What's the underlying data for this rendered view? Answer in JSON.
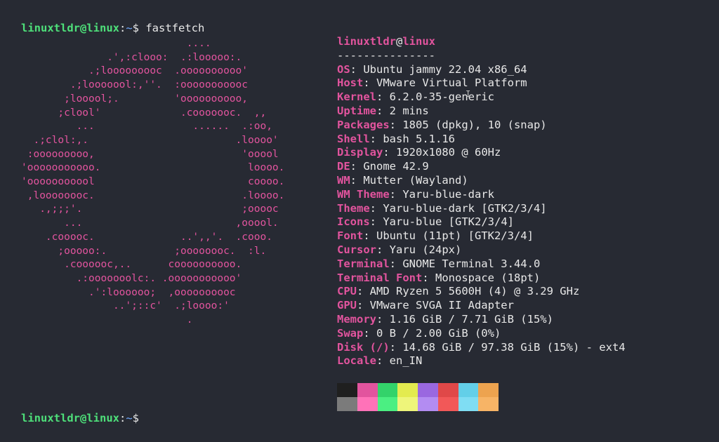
{
  "prompt": {
    "user_host": "linuxtldr@linux",
    "separator": ":",
    "path": "~",
    "dollar": "$ ",
    "command": "fastfetch"
  },
  "ascii_logo": [
    "                           ....",
    "              .',:clooo:  .:looooo:.",
    "           .;looooooooc  .oooooooooo'",
    "        .;looooool:,''.  :ooooooooooc",
    "       ;looool;.         'oooooooooo,",
    "      ;clool'             .cooooooc.  ,,",
    "         ...                ......  .:oo,",
    "  .;clol:,.                        .loooo'",
    " :ooooooooo,                        'ooool",
    "'ooooooooooo.                        loooo.",
    "'ooooooooool                         coooo.",
    " ,loooooooc.                        .loooo.",
    "   .,;;;'.                          ;ooooc",
    "       ...                         ,ooool.",
    "    .cooooc.              ..',,'.  .cooo.",
    "      ;ooooo:.           ;oooooooc.  :l.",
    "       .coooooc,..      coooooooooo.",
    "         .:ooooooolc:. .ooooooooooo'",
    "           .':loooooo;  ,oooooooooc",
    "               ..';::c'  .;loooo:'",
    "                           ."
  ],
  "info": {
    "title_user": "linuxtldr",
    "title_at": "@",
    "title_host": "linux",
    "separator_line": "---------------",
    "rows": [
      {
        "key": "OS",
        "value": "Ubuntu jammy 22.04 x86_64"
      },
      {
        "key": "Host",
        "value": "VMware Virtual Platform"
      },
      {
        "key": "Kernel",
        "value": "6.2.0-35-generic"
      },
      {
        "key": "Uptime",
        "value": "2 mins"
      },
      {
        "key": "Packages",
        "value": "1805 (dpkg), 10 (snap)"
      },
      {
        "key": "Shell",
        "value": "bash 5.1.16"
      },
      {
        "key": "Display",
        "value": "1920x1080 @ 60Hz"
      },
      {
        "key": "DE",
        "value": "Gnome 42.9"
      },
      {
        "key": "WM",
        "value": "Mutter (Wayland)"
      },
      {
        "key": "WM Theme",
        "value": "Yaru-blue-dark"
      },
      {
        "key": "Theme",
        "value": "Yaru-blue-dark [GTK2/3/4]"
      },
      {
        "key": "Icons",
        "value": "Yaru-blue [GTK2/3/4]"
      },
      {
        "key": "Font",
        "value": "Ubuntu (11pt) [GTK2/3/4]"
      },
      {
        "key": "Cursor",
        "value": "Yaru (24px)"
      },
      {
        "key": "Terminal",
        "value": "GNOME Terminal 3.44.0"
      },
      {
        "key": "Terminal Font",
        "value": "Monospace (18pt)"
      },
      {
        "key": "CPU",
        "value": "AMD Ryzen 5 5600H (4) @ 3.29 GHz"
      },
      {
        "key": "GPU",
        "value": "VMware SVGA II Adapter"
      },
      {
        "key": "Memory",
        "value": "1.16 GiB / 7.71 GiB (15%)"
      },
      {
        "key": "Swap",
        "value": "0 B / 2.00 GiB (0%)"
      },
      {
        "key": "Disk (/)",
        "value": "14.68 GiB / 97.38 GiB (15%) - ext4"
      },
      {
        "key": "Locale",
        "value": "en_IN"
      }
    ]
  },
  "colors": {
    "background": "#272a33",
    "accent": "#e2549e",
    "prompt_user": "#4ee07a",
    "prompt_path": "#6ea8ff",
    "palette_top": [
      "#1f1f1f",
      "#e2549e",
      "#33d36a",
      "#e3eb4f",
      "#9a68e0",
      "#e04848",
      "#63cfe8",
      "#eda34f"
    ],
    "palette_bottom": [
      "#7b7b7b",
      "#ff72b8",
      "#4bef82",
      "#eef57a",
      "#b38cf2",
      "#f25858",
      "#7fddf3",
      "#f7b466"
    ]
  },
  "cursor_icon": "text-cursor-icon"
}
